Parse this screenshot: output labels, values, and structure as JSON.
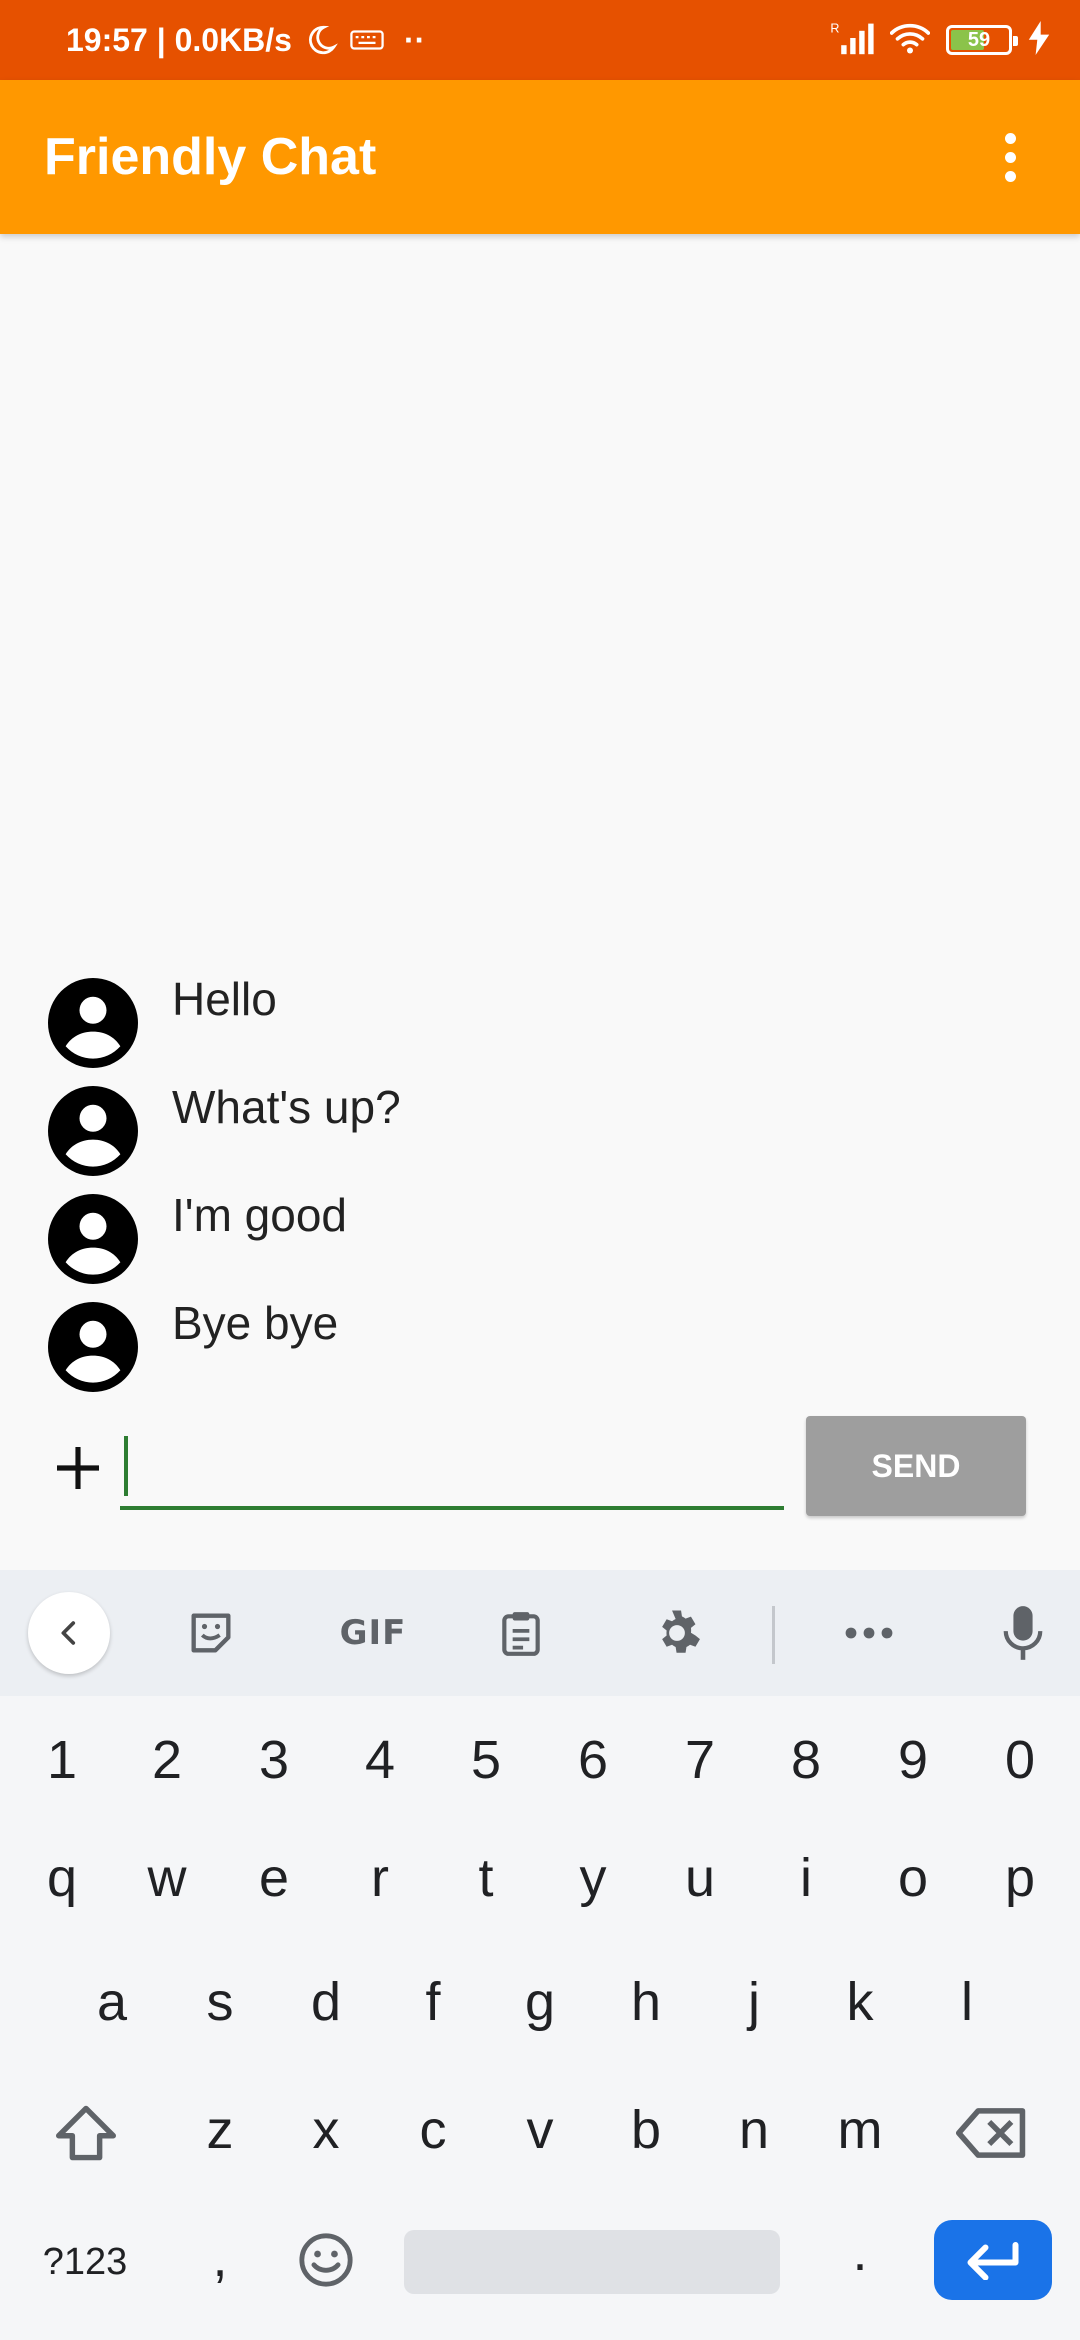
{
  "status_bar": {
    "time_speed": "19:57 | 0.0KB/s",
    "dots": "··",
    "battery_level": "59",
    "icons": [
      "moon-icon",
      "keyboard-icon",
      "signal-icon",
      "wifi-icon",
      "battery-icon",
      "charging-icon"
    ]
  },
  "app_bar": {
    "title": "Friendly Chat",
    "menu_icon": "more-vert-icon",
    "background": "#ff9800",
    "status_background": "#e65100"
  },
  "messages": [
    {
      "text": "Hello",
      "avatar_icon": "account-circle-icon"
    },
    {
      "text": "What's up?",
      "avatar_icon": "account-circle-icon"
    },
    {
      "text": "I'm good",
      "avatar_icon": "account-circle-icon"
    },
    {
      "text": "Bye bye",
      "avatar_icon": "account-circle-icon"
    }
  ],
  "composer": {
    "add_icon": "plus-icon",
    "input_value": "",
    "send_label": "SEND",
    "underline_color": "#2e7d32",
    "send_color": "#9e9e9e"
  },
  "keyboard": {
    "toolbar": {
      "gif_label": "GIF",
      "icons": [
        "chevron-left-icon",
        "sticker-icon",
        "gif-icon",
        "clipboard-icon",
        "gear-icon",
        "more-horiz-icon",
        "mic-icon"
      ]
    },
    "row_numbers": [
      "1",
      "2",
      "3",
      "4",
      "5",
      "6",
      "7",
      "8",
      "9",
      "0"
    ],
    "row_top": [
      "q",
      "w",
      "e",
      "r",
      "t",
      "y",
      "u",
      "i",
      "o",
      "p"
    ],
    "row_middle": [
      "a",
      "s",
      "d",
      "f",
      "g",
      "h",
      "j",
      "k",
      "l"
    ],
    "row_bottom": [
      "z",
      "x",
      "c",
      "v",
      "b",
      "n",
      "m"
    ],
    "symbols_label": "?123",
    "comma_label": ",",
    "period_label": ".",
    "enter_color": "#1a73e8"
  }
}
